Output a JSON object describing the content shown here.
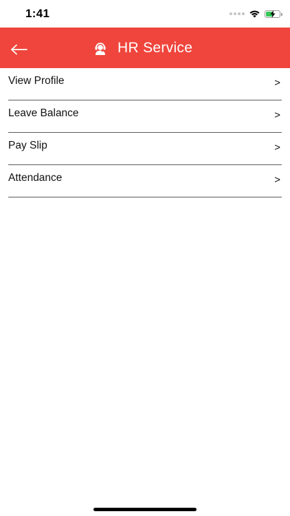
{
  "status_bar": {
    "time": "1:41",
    "battery_level": 0.55,
    "icons": [
      "signal-icon",
      "wifi-icon",
      "battery-charging-icon"
    ]
  },
  "header": {
    "title": "HR Service",
    "back_icon": "arrow-left-icon",
    "title_icon": "support-agent-icon",
    "background_color": "#ef453c"
  },
  "menu": {
    "items": [
      {
        "label": "View Profile",
        "chevron": ">"
      },
      {
        "label": "Leave Balance",
        "chevron": ">"
      },
      {
        "label": "Pay Slip",
        "chevron": ">"
      },
      {
        "label": "Attendance",
        "chevron": ">"
      }
    ]
  }
}
